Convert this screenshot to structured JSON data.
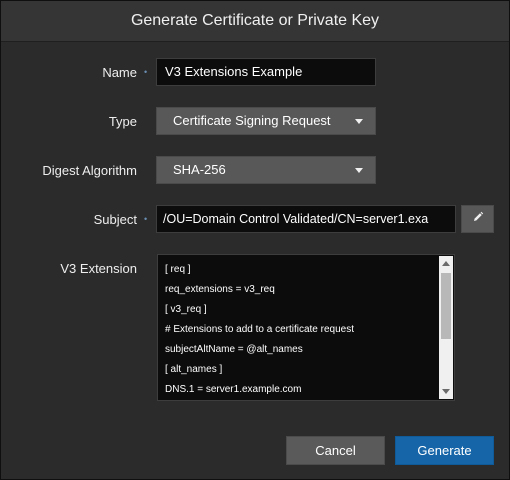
{
  "dialog": {
    "title": "Generate Certificate or Private Key"
  },
  "form": {
    "name": {
      "label": "Name",
      "required_marker": "•",
      "value": "V3 Extensions Example"
    },
    "type": {
      "label": "Type",
      "value": "Certificate Signing Request"
    },
    "digest": {
      "label": "Digest Algorithm",
      "value": "SHA-256"
    },
    "subject": {
      "label": "Subject",
      "required_marker": "•",
      "value": "/OU=Domain Control Validated/CN=server1.exa",
      "edit_icon": "pencil-icon"
    },
    "v3_extension": {
      "label": "V3 Extension",
      "lines": [
        "[ req ]",
        "req_extensions = v3_req",
        "[ v3_req ]",
        "# Extensions to add to a certificate request",
        "subjectAltName = @alt_names",
        "[ alt_names ]",
        "DNS.1 = server1.example.com"
      ]
    }
  },
  "buttons": {
    "cancel": "Cancel",
    "generate": "Generate"
  },
  "colors": {
    "primary": "#1565a8",
    "background": "#2b2b2b",
    "input_bg": "#0c0c0c"
  }
}
